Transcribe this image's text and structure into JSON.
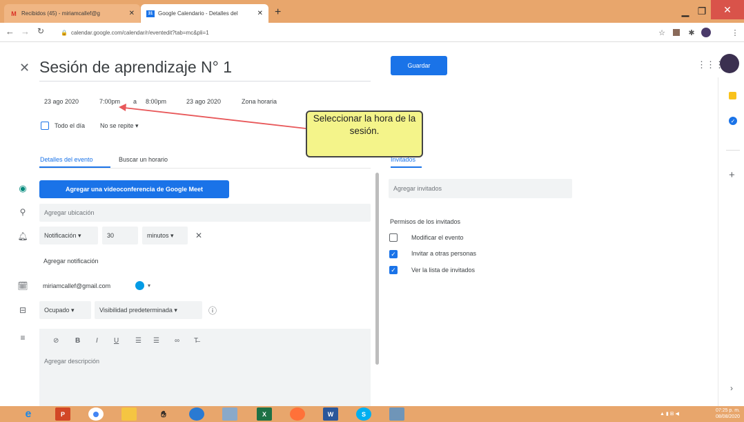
{
  "browser": {
    "tabs": [
      {
        "label": "Recibidos (45) - miriamcallef@g",
        "icon": "gmail-icon"
      },
      {
        "label": "Google Calendario - Detalles del",
        "icon": "calendar-icon"
      }
    ],
    "url": "calendar.google.com/calendar/r/eventedit?tab=mc&pli=1"
  },
  "event": {
    "title": "Sesión de aprendizaje N° 1",
    "save_label": "Guardar",
    "start_date": "23 ago 2020",
    "start_time": "7:00pm",
    "to_label": "a",
    "end_time": "8:00pm",
    "end_date": "23 ago 2020",
    "timezone_label": "Zona horaria",
    "all_day_label": "Todo el día",
    "repeat_label": "No se repite"
  },
  "tabs": {
    "details": "Detalles del evento",
    "find_time": "Buscar un horario",
    "guests": "Invitados"
  },
  "details": {
    "meet_button": "Agregar una videoconferencia de Google Meet",
    "location_placeholder": "Agregar ubicación",
    "notification_type": "Notificación",
    "notification_value": "30",
    "notification_unit": "minutos",
    "add_notification": "Agregar notificación",
    "calendar_owner": "miriamcallef@gmail.com",
    "availability": "Ocupado",
    "visibility": "Visibilidad predeterminada",
    "description_placeholder": "Agregar descripción"
  },
  "guests": {
    "add_placeholder": "Agregar invitados",
    "permissions_title": "Permisos de los invitados",
    "permissions": [
      {
        "label": "Modificar el evento",
        "checked": false
      },
      {
        "label": "Invitar a otras personas",
        "checked": true
      },
      {
        "label": "Ver la lista de invitados",
        "checked": true
      }
    ]
  },
  "annotation": {
    "text": "Seleccionar la hora de la sesión."
  },
  "taskbar": {
    "clock_time": "07:25 p. m.",
    "clock_date": "08/08/2020"
  },
  "colors": {
    "accent": "#1a73e8",
    "chrome": "#e8a66c",
    "callout": "#f4f48a",
    "arrow": "#e8585a"
  }
}
